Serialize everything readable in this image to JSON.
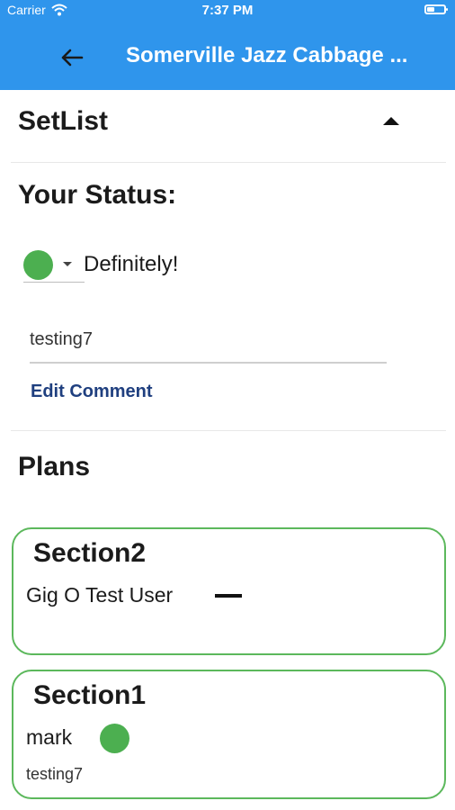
{
  "status_bar": {
    "carrier": "Carrier",
    "time": "7:37 PM"
  },
  "header": {
    "title": "Somerville Jazz Cabbage ...",
    "background": "#2f95ec"
  },
  "setlist": {
    "title": "SetList",
    "toggle_icon": "caret-up-icon"
  },
  "your_status": {
    "title": "Your Status:",
    "status_color": "#4caf50",
    "status_label": "Definitely!",
    "comment_value": "testing7",
    "edit_comment_label": "Edit Comment"
  },
  "plans": {
    "title": "Plans",
    "sections": [
      {
        "name": "Section2",
        "members": [
          {
            "name": "Gig O Test User",
            "status_icon": "dash-icon"
          }
        ]
      },
      {
        "name": "Section1",
        "members": [
          {
            "name": "mark",
            "status_icon": "green-dot-icon",
            "comment": "testing7"
          }
        ]
      }
    ]
  }
}
